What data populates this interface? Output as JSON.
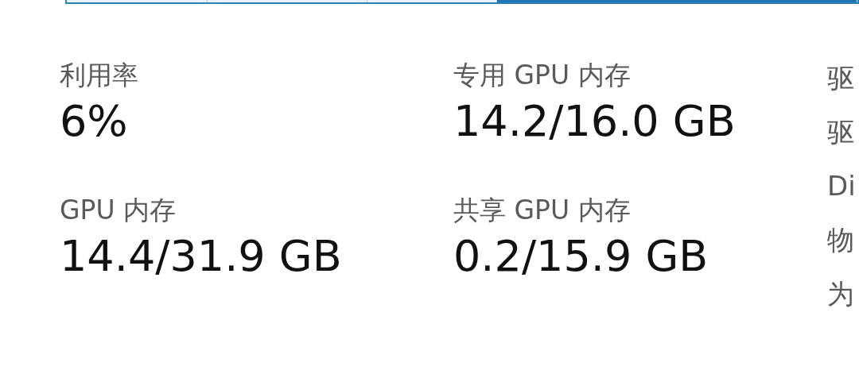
{
  "stats": [
    {
      "label": "利用率",
      "value": "6%"
    },
    {
      "label": "专用 GPU 内存",
      "value": "14.2/16.0 GB"
    },
    {
      "label": "GPU 内存",
      "value": "14.4/31.9 GB"
    },
    {
      "label": "共享 GPU 内存",
      "value": "0.2/15.9 GB"
    }
  ],
  "side_labels": [
    "驱",
    "驱",
    "Di",
    "物",
    "为"
  ]
}
